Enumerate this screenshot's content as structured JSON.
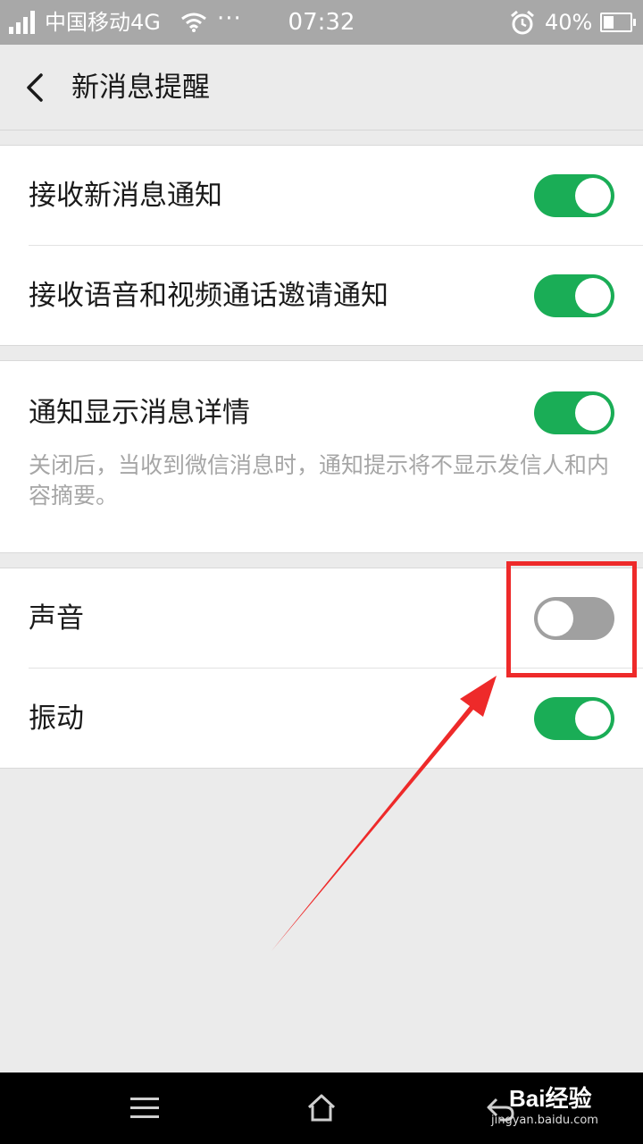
{
  "status_bar": {
    "carrier": "中国移动4G",
    "more": "···",
    "time": "07:32",
    "battery": "40%",
    "battery_level": 0.4,
    "icons": [
      "signal-icon",
      "wifi-icon",
      "alarm-icon",
      "battery-icon"
    ]
  },
  "header": {
    "back_icon": "chevron-left-icon",
    "title": "新消息提醒"
  },
  "groups": [
    {
      "rows": [
        {
          "label": "接收新消息通知",
          "toggle": "on"
        },
        {
          "label": "接收语音和视频通话邀请通知",
          "toggle": "on"
        }
      ]
    },
    {
      "rows": [
        {
          "label": "通知显示消息详情",
          "toggle": "on",
          "description": "关闭后，当收到微信消息时，通知提示将不显示发信人和内容摘要。"
        }
      ]
    },
    {
      "rows": [
        {
          "label": "声音",
          "toggle": "off"
        },
        {
          "label": "振动",
          "toggle": "on"
        }
      ]
    }
  ],
  "nav_bar": {
    "icons": [
      "menu-icon",
      "home-icon",
      "back-icon"
    ]
  },
  "watermark": {
    "brand": "Bai经验",
    "url": "jingyan.baidu.com"
  },
  "colors": {
    "toggle_on": "#1aad56",
    "toggle_off": "#a0a0a0",
    "annotation": "#ee2a2a",
    "status_bar": "#a8a8a8",
    "background": "#ebebeb"
  }
}
